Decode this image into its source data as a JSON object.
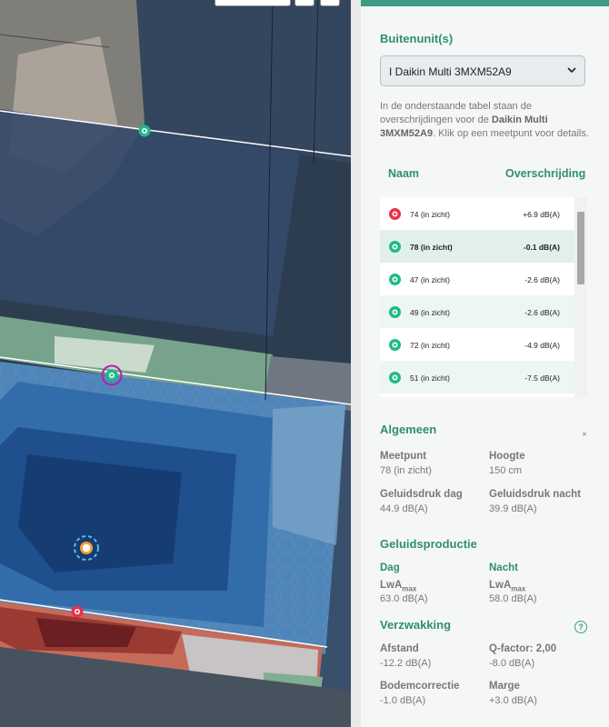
{
  "colors": {
    "accent": "#2e8f6f",
    "red_marker": "#e8314a",
    "green_marker": "#1fb98a",
    "orange_marker": "#f2a12e"
  },
  "buitenunit": {
    "heading": "Buitenunit(s)",
    "selected": "I Daikin Multi 3MXM52A9",
    "desc_pre": "In de onderstaande tabel staan de overschrijdingen voor de ",
    "desc_bold": "Daikin Multi 3MXM52A9",
    "desc_post": ". Klik op een meetpunt voor details."
  },
  "table": {
    "col_name": "Naam",
    "col_over": "Overschrijding",
    "rows": [
      {
        "name": "74 (in zicht)",
        "over": "+6.9 dB(A)",
        "icon": "red-marker-icon",
        "selected": false
      },
      {
        "name": "78 (in zicht)",
        "over": "-0.1 dB(A)",
        "icon": "green-marker-icon",
        "selected": true
      },
      {
        "name": "47 (in zicht)",
        "over": "-2.6 dB(A)",
        "icon": "green-marker-icon",
        "selected": false
      },
      {
        "name": "49 (in zicht)",
        "over": "-2.6 dB(A)",
        "icon": "green-marker-icon",
        "selected": false
      },
      {
        "name": "72 (in zicht)",
        "over": "-4.9 dB(A)",
        "icon": "green-marker-icon",
        "selected": false
      },
      {
        "name": "51 (in zicht)",
        "over": "-7.5 dB(A)",
        "icon": "green-marker-icon",
        "selected": false
      }
    ]
  },
  "algemeen": {
    "heading": "Algemeen",
    "close": "×",
    "meetpunt_label": "Meetpunt",
    "meetpunt_value": "78 (in zicht)",
    "hoogte_label": "Hoogte",
    "hoogte_value": "150 cm",
    "dag_label": "Geluidsdruk dag",
    "dag_value": "44.9 dB(A)",
    "nacht_label": "Geluidsdruk nacht",
    "nacht_value": "39.9 dB(A)"
  },
  "productie": {
    "heading": "Geluidsproductie",
    "dag": "Dag",
    "nacht": "Nacht",
    "lwa": "LwA",
    "lwa_sub": "max",
    "dag_value": "63.0 dB(A)",
    "nacht_value": "58.0 dB(A)"
  },
  "verzwakking": {
    "heading": "Verzwakking",
    "help": "?",
    "afstand_label": "Afstand",
    "afstand_value": "-12.2 dB(A)",
    "q_label": "Q-factor: 2,00",
    "q_value": "-8.0 dB(A)",
    "bodem_label": "Bodemcorrectie",
    "bodem_value": "-1.0 dB(A)",
    "marge_label": "Marge",
    "marge_value": "+3.0 dB(A)"
  }
}
